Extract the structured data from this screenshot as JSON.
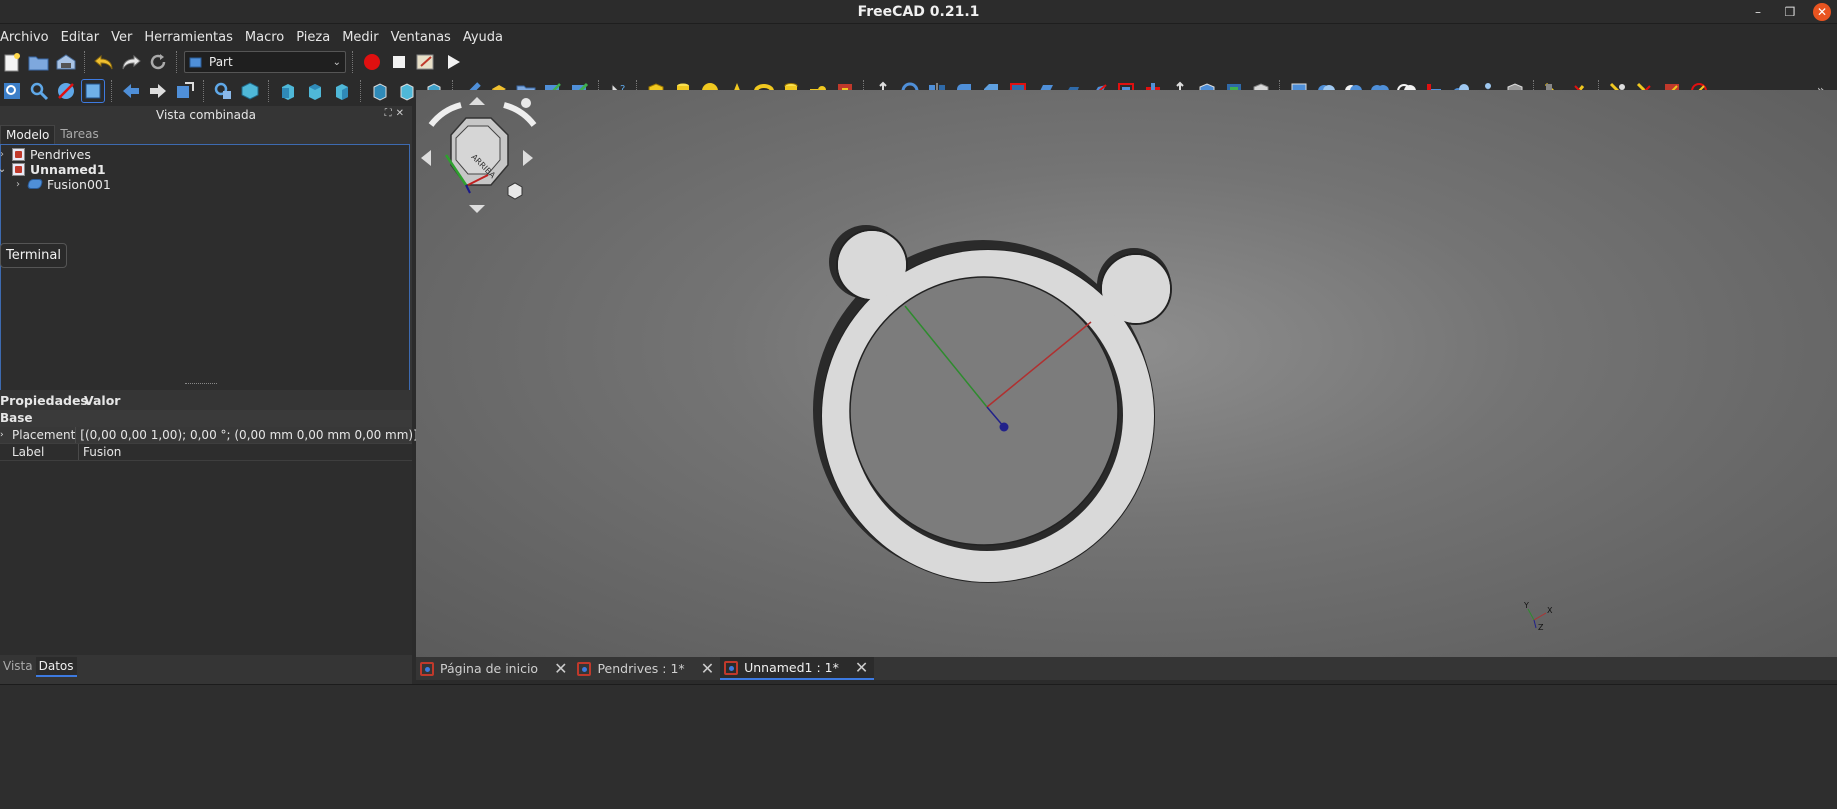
{
  "window": {
    "title": "FreeCAD 0.21.1"
  },
  "menu": [
    "Archivo",
    "Editar",
    "Ver",
    "Herramientas",
    "Macro",
    "Pieza",
    "Medir",
    "Ventanas",
    "Ayuda"
  ],
  "workbench": {
    "selected": "Part"
  },
  "combo_view": {
    "title": "Vista combinada",
    "tabs": [
      "Modelo",
      "Tareas"
    ],
    "tree": [
      {
        "label": "Pendrives",
        "icon": "document-icon",
        "bold": false
      },
      {
        "label": "Unnamed1",
        "icon": "document-icon",
        "bold": true
      },
      {
        "label": "Fusion001",
        "icon": "solid-icon",
        "bold": false
      }
    ],
    "tooltip": "Terminal"
  },
  "properties": {
    "headers": [
      "Propiedades",
      "Valor"
    ],
    "group": "Base",
    "rows": [
      {
        "key": "Placement",
        "value": "[(0,00 0,00 1,00); 0,00 °; (0,00 mm  0,00 mm  0,00 mm)]"
      },
      {
        "key": "Label",
        "value": "Fusion"
      }
    ],
    "tabs": [
      "Vista",
      "Datos"
    ]
  },
  "navcube": {
    "face_label": "ARRIBA"
  },
  "axis_labels": {
    "x": "X",
    "y": "Y",
    "z": "Z"
  },
  "doc_tabs": [
    {
      "label": "Página de inicio",
      "active": false
    },
    {
      "label": "Pendrives : 1*",
      "active": false
    },
    {
      "label": "Unnamed1 : 1*",
      "active": true
    }
  ],
  "colors": {
    "accent": "#3d7ae0",
    "close": "#e95420",
    "part_face": "#d9d9d9",
    "x_axis": "#b03030",
    "y_axis": "#2e8b2e",
    "z_axis": "#22228a"
  }
}
